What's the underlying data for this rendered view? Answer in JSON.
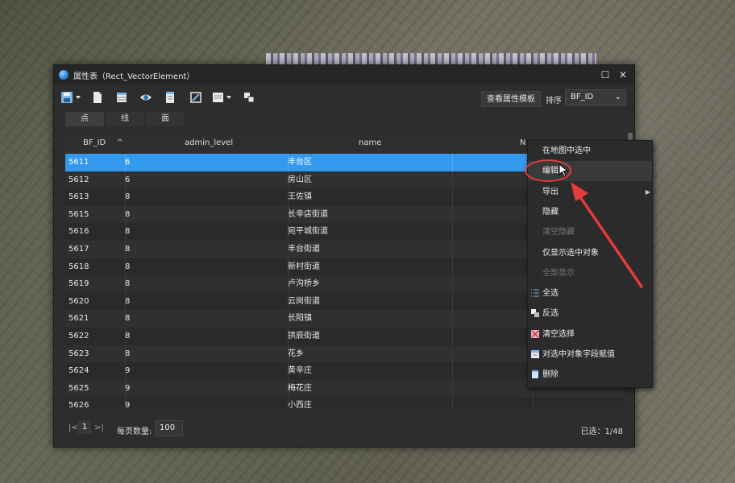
{
  "window": {
    "title": "属性表（Rect_VectorElement）",
    "maximize_icon": "maximize-icon",
    "close_icon": "close-icon"
  },
  "toolbar": {
    "icons": [
      "save-dropdown-icon",
      "new-doc-icon",
      "table-icon",
      "eye-icon",
      "list-doc-icon",
      "fit-select-icon",
      "view-dropdown-icon",
      "layers-icon"
    ],
    "template_button": "查看属性模板",
    "sort_label": "排序",
    "sort_value": "BF_ID"
  },
  "tabs": [
    {
      "label": "点",
      "active": true
    },
    {
      "label": "线",
      "active": false
    },
    {
      "label": "面",
      "active": false
    }
  ],
  "table": {
    "columns": [
      "BF_ID",
      "admin_level",
      "name",
      "N"
    ],
    "sort_indicator": "^",
    "rows": [
      {
        "id": "5611",
        "level": "6",
        "name": "丰台区",
        "selected": true
      },
      {
        "id": "5612",
        "level": "6",
        "name": "房山区"
      },
      {
        "id": "5613",
        "level": "8",
        "name": "王佐镇"
      },
      {
        "id": "5615",
        "level": "8",
        "name": "长辛店街道"
      },
      {
        "id": "5616",
        "level": "8",
        "name": "宛平城街道"
      },
      {
        "id": "5617",
        "level": "8",
        "name": "丰台街道"
      },
      {
        "id": "5618",
        "level": "8",
        "name": "新村街道"
      },
      {
        "id": "5619",
        "level": "8",
        "name": "卢沟桥乡"
      },
      {
        "id": "5620",
        "level": "8",
        "name": "云岗街道"
      },
      {
        "id": "5621",
        "level": "8",
        "name": "长阳镇"
      },
      {
        "id": "5622",
        "level": "8",
        "name": "拱辰街道"
      },
      {
        "id": "5623",
        "level": "8",
        "name": "花乡"
      },
      {
        "id": "5624",
        "level": "9",
        "name": "黄辛庄"
      },
      {
        "id": "5625",
        "level": "9",
        "name": "梅花庄"
      },
      {
        "id": "5626",
        "level": "9",
        "name": "小西庄"
      }
    ]
  },
  "footer": {
    "first_icon": "|<",
    "page": "1",
    "next_icon": ">|",
    "per_page_label": "每页数量:",
    "per_page_value": "100",
    "selected_count": "已选：1/48"
  },
  "context_menu": {
    "items": [
      {
        "label": "在地图中选中",
        "state": "normal"
      },
      {
        "label": "编辑",
        "state": "hover"
      },
      {
        "label": "导出",
        "state": "normal",
        "submenu": true
      },
      {
        "label": "隐藏",
        "state": "normal"
      },
      {
        "label": "清空隐藏",
        "state": "disabled"
      },
      {
        "label": "仅显示选中对象",
        "state": "normal"
      },
      {
        "label": "全部显示",
        "state": "disabled"
      },
      {
        "label": "全选",
        "state": "normal",
        "icon": "select-all-icon"
      },
      {
        "label": "反选",
        "state": "normal",
        "icon": "invert-select-icon"
      },
      {
        "label": "清空选择",
        "state": "normal",
        "icon": "clear-selection-icon"
      },
      {
        "label": "对选中对象字段赋值",
        "state": "normal",
        "icon": "assign-field-icon"
      },
      {
        "label": "删除",
        "state": "normal",
        "icon": "delete-icon"
      }
    ],
    "submenu_arrow": "▶"
  },
  "colors": {
    "selection": "#3399ee",
    "annotation": "#e43b3b"
  }
}
